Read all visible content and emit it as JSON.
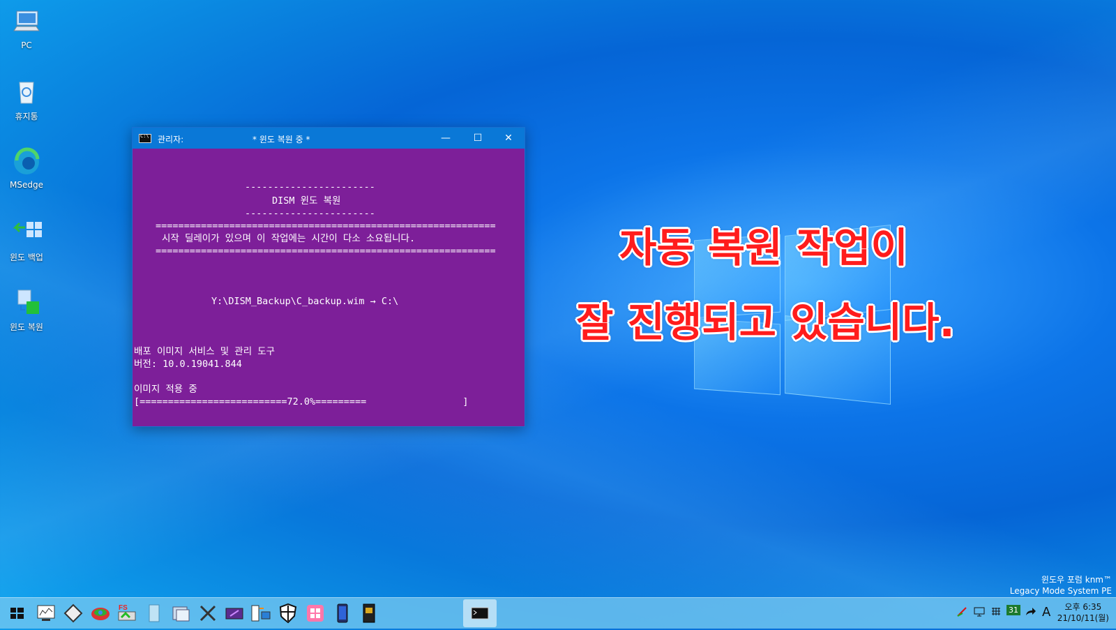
{
  "desktop": {
    "icons": [
      {
        "label": "PC",
        "icon": "pc-icon"
      },
      {
        "label": "휴지통",
        "icon": "recycle-bin-icon"
      },
      {
        "label": "MSedge",
        "icon": "edge-icon"
      },
      {
        "label": "윈도 백업",
        "icon": "backup-icon"
      },
      {
        "label": "윈도 복원",
        "icon": "restore-icon"
      }
    ],
    "overlay_line1": "자동 복원 작업이",
    "overlay_line2": "잘 진행되고 있습니다.",
    "brand_line1": "윈도우 포럼 knm™",
    "brand_line2": "Legacy Mode System PE"
  },
  "console_window": {
    "title_left": "관리자:",
    "title_center": "* 윈도 복원 중 *",
    "minimize": "—",
    "maximize": "☐",
    "close": "✕",
    "lines": {
      "dash_top": "-----------------------",
      "heading": "DISM 윈도 복원",
      "dash_bottom": "-----------------------",
      "eq_top": "============================================================",
      "notice": "시작 딜레이가 있으며 이 작업에는 시간이 다소 소요됩니다.",
      "eq_bottom": "============================================================",
      "path": "Y:\\DISM_Backup\\C_backup.wim → C:\\",
      "tool": "배포 이미지 서비스 및 관리 도구",
      "version": "버전: 10.0.19041.844",
      "status": "이미지 적용 중",
      "progress": "[==========================72.0%=========                 ]"
    },
    "progress_percent": 72.0
  },
  "taskbar": {
    "start": "start-icon",
    "apps": [
      "system-monitor-icon",
      "disk-tool-icon",
      "partition-icon",
      "fs-backup-icon",
      "notepad-icon",
      "explorer-icon",
      "tools-icon",
      "media-icon",
      "file-manager-icon",
      "shield-icon",
      "windows-store-icon",
      "phone-icon",
      "sd-card-icon"
    ],
    "active_app": "console-icon",
    "tray_ime": "A",
    "clock_time": "오후 6:35",
    "clock_date": "21/10/11(월)",
    "calendar_day": "31"
  }
}
